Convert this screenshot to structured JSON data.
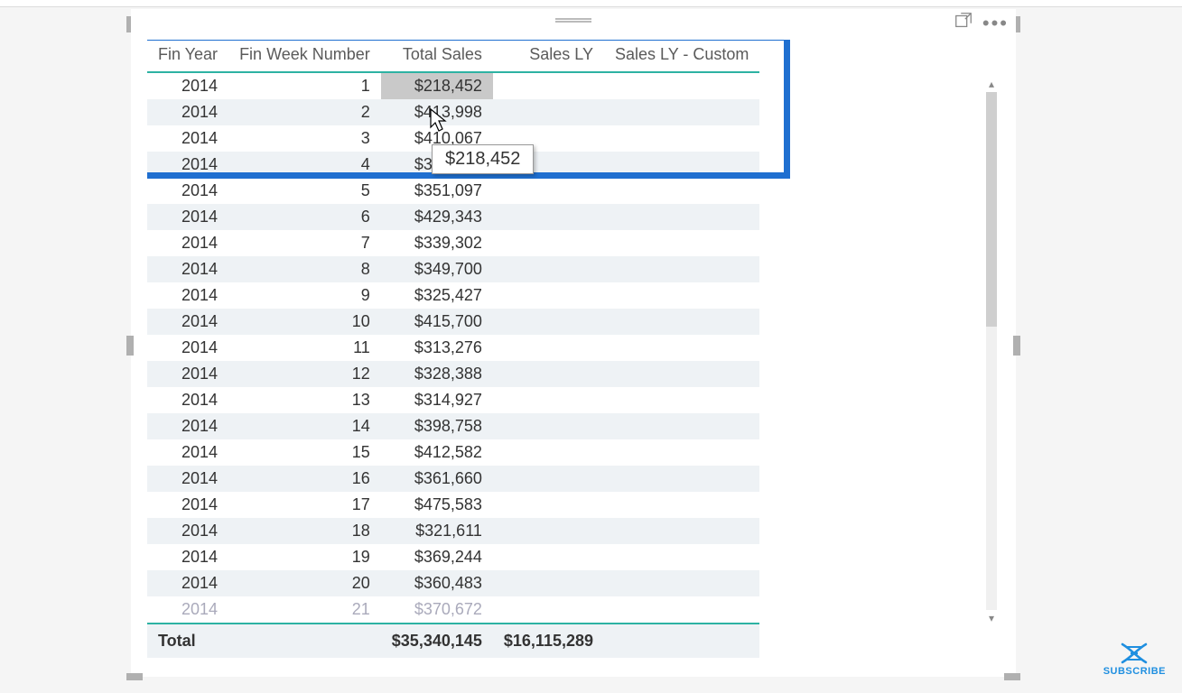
{
  "tooltip": {
    "value": "$218,452"
  },
  "table": {
    "headers": {
      "col0": "Fin Year",
      "col1": "Fin Week Number",
      "col2": "Total Sales",
      "col3": "Sales LY",
      "col4": "Sales LY - Custom"
    },
    "rows": [
      {
        "year": "2014",
        "week": "1",
        "total": "$218,452",
        "ly": "",
        "lyc": ""
      },
      {
        "year": "2014",
        "week": "2",
        "total": "$413,998",
        "ly": "",
        "lyc": ""
      },
      {
        "year": "2014",
        "week": "3",
        "total": "$410,067",
        "ly": "",
        "lyc": ""
      },
      {
        "year": "2014",
        "week": "4",
        "total": "$375,088",
        "ly": "",
        "lyc": ""
      },
      {
        "year": "2014",
        "week": "5",
        "total": "$351,097",
        "ly": "",
        "lyc": ""
      },
      {
        "year": "2014",
        "week": "6",
        "total": "$429,343",
        "ly": "",
        "lyc": ""
      },
      {
        "year": "2014",
        "week": "7",
        "total": "$339,302",
        "ly": "",
        "lyc": ""
      },
      {
        "year": "2014",
        "week": "8",
        "total": "$349,700",
        "ly": "",
        "lyc": ""
      },
      {
        "year": "2014",
        "week": "9",
        "total": "$325,427",
        "ly": "",
        "lyc": ""
      },
      {
        "year": "2014",
        "week": "10",
        "total": "$415,700",
        "ly": "",
        "lyc": ""
      },
      {
        "year": "2014",
        "week": "11",
        "total": "$313,276",
        "ly": "",
        "lyc": ""
      },
      {
        "year": "2014",
        "week": "12",
        "total": "$328,388",
        "ly": "",
        "lyc": ""
      },
      {
        "year": "2014",
        "week": "13",
        "total": "$314,927",
        "ly": "",
        "lyc": ""
      },
      {
        "year": "2014",
        "week": "14",
        "total": "$398,758",
        "ly": "",
        "lyc": ""
      },
      {
        "year": "2014",
        "week": "15",
        "total": "$412,582",
        "ly": "",
        "lyc": ""
      },
      {
        "year": "2014",
        "week": "16",
        "total": "$361,660",
        "ly": "",
        "lyc": ""
      },
      {
        "year": "2014",
        "week": "17",
        "total": "$475,583",
        "ly": "",
        "lyc": ""
      },
      {
        "year": "2014",
        "week": "18",
        "total": "$321,611",
        "ly": "",
        "lyc": ""
      },
      {
        "year": "2014",
        "week": "19",
        "total": "$369,244",
        "ly": "",
        "lyc": ""
      },
      {
        "year": "2014",
        "week": "20",
        "total": "$360,483",
        "ly": "",
        "lyc": ""
      }
    ],
    "partial_row": {
      "year": "2014",
      "week": "21",
      "total": "$370,672",
      "ly": "",
      "lyc": ""
    },
    "totals": {
      "label": "Total",
      "total": "$35,340,145",
      "ly": "$16,115,289",
      "lyc": ""
    }
  },
  "badge": {
    "label": "SUBSCRIBE"
  }
}
